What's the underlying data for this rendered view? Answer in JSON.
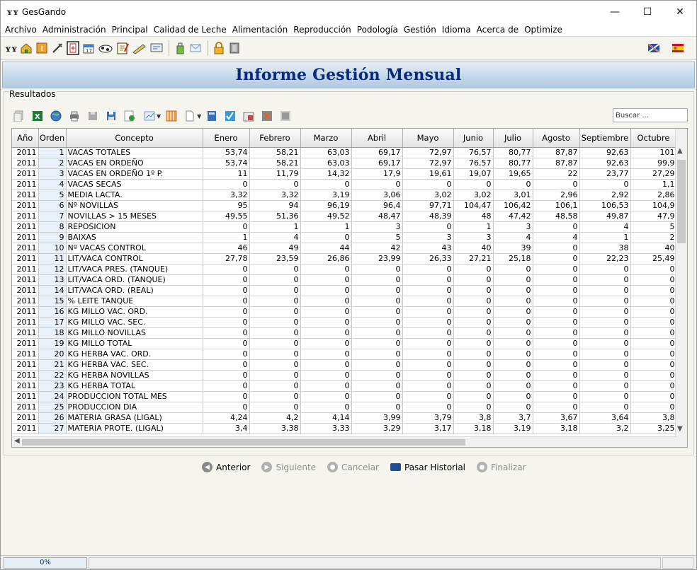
{
  "window": {
    "title": "GesGando",
    "app_icon": "ʏʏ",
    "controls": [
      "—",
      "☐",
      "✕"
    ]
  },
  "menu": [
    "Archivo",
    "Administración",
    "Principal",
    "Calidad de Leche",
    "Alimentación",
    "Reproducción",
    "Podología",
    "Gestión",
    "Idioma",
    "Acerca de",
    "Optimize"
  ],
  "toolbar": {
    "icons": [
      "cow-logo-icon",
      "home-icon",
      "alert-icon",
      "syringe-icon",
      "calculator-icon",
      "calendar-icon",
      "cow-icon",
      "notepad-icon",
      "pen-edit-icon",
      "screen-icon",
      "bottle-icon",
      "mail-icon",
      "lock-icon",
      "door-icon"
    ],
    "right_icons": [
      "flag-uk-icon",
      "flag-es-icon"
    ]
  },
  "banner": {
    "title": "Informe Gestión Mensual"
  },
  "results": {
    "label": "Resultados",
    "search_placeholder": "Buscar ...",
    "grid_icons": [
      "copy-icon",
      "excel-icon",
      "globe-icon",
      "print-icon",
      "save-gray-icon",
      "save-icon",
      "refresh-sheet-icon",
      "chart-icon",
      "columns-icon",
      "page-icon",
      "calc-icon",
      "formula-icon",
      "import-icon",
      "export-icon",
      "barcode-icon"
    ]
  },
  "grid": {
    "columns": [
      "Año",
      "Orden",
      "Concepto",
      "Enero",
      "Febrero",
      "Marzo",
      "Abril",
      "Mayo",
      "Junio",
      "Julio",
      "Agosto",
      "Septiembre",
      "Octubre"
    ],
    "rows": [
      [
        "2011",
        "1",
        "VACAS TOTALES",
        "53,74",
        "58,21",
        "63,03",
        "69,17",
        "72,97",
        "76,57",
        "80,77",
        "87,87",
        "92,63",
        "101"
      ],
      [
        "2011",
        "2",
        "VACAS EN ORDEÑO",
        "53,74",
        "58,21",
        "63,03",
        "69,17",
        "72,97",
        "76,57",
        "80,77",
        "87,87",
        "92,63",
        "99,9"
      ],
      [
        "2011",
        "3",
        "VACAS EN ORDEÑO 1º P.",
        "11",
        "11,79",
        "14,32",
        "17,9",
        "19,61",
        "19,07",
        "19,65",
        "22",
        "23,77",
        "27,29"
      ],
      [
        "2011",
        "4",
        "VACAS SECAS",
        "0",
        "0",
        "0",
        "0",
        "0",
        "0",
        "0",
        "0",
        "0",
        "1,1"
      ],
      [
        "2011",
        "5",
        "MEDIA LACTA.",
        "3,32",
        "3,32",
        "3,19",
        "3,06",
        "3,02",
        "3,02",
        "3,01",
        "2,96",
        "2,92",
        "2,86"
      ],
      [
        "2011",
        "6",
        "Nº NOVILLAS",
        "95",
        "94",
        "96,19",
        "96,4",
        "97,71",
        "104,47",
        "106,42",
        "106,1",
        "106,53",
        "104,9"
      ],
      [
        "2011",
        "7",
        "NOVILLAS > 15 MESES",
        "49,55",
        "51,36",
        "49,52",
        "48,47",
        "48,39",
        "48",
        "47,42",
        "48,58",
        "49,87",
        "47,9"
      ],
      [
        "2011",
        "8",
        "REPOSICION",
        "0",
        "1",
        "1",
        "3",
        "0",
        "1",
        "3",
        "0",
        "4",
        "5"
      ],
      [
        "2011",
        "9",
        "BAIXAS",
        "1",
        "4",
        "0",
        "5",
        "3",
        "3",
        "4",
        "4",
        "1",
        "2"
      ],
      [
        "2011",
        "10",
        "Nº VACAS CONTROL",
        "46",
        "49",
        "44",
        "42",
        "43",
        "40",
        "39",
        "0",
        "38",
        "40"
      ],
      [
        "2011",
        "11",
        "LIT/VACA CONTROL",
        "27,78",
        "23,59",
        "26,86",
        "23,99",
        "26,33",
        "27,21",
        "25,18",
        "0",
        "22,23",
        "25,49"
      ],
      [
        "2011",
        "12",
        "LIT/VACA PRES. (TANQUE)",
        "0",
        "0",
        "0",
        "0",
        "0",
        "0",
        "0",
        "0",
        "0",
        "0"
      ],
      [
        "2011",
        "13",
        "LIT/VACA ORD. (TANQUE)",
        "0",
        "0",
        "0",
        "0",
        "0",
        "0",
        "0",
        "0",
        "0",
        "0"
      ],
      [
        "2011",
        "14",
        "LIT/VACA ORD. (REAL)",
        "0",
        "0",
        "0",
        "0",
        "0",
        "0",
        "0",
        "0",
        "0",
        "0"
      ],
      [
        "2011",
        "15",
        "% LEITE TANQUE",
        "0",
        "0",
        "0",
        "0",
        "0",
        "0",
        "0",
        "0",
        "0",
        "0"
      ],
      [
        "2011",
        "16",
        "KG MILLO VAC. ORD.",
        "0",
        "0",
        "0",
        "0",
        "0",
        "0",
        "0",
        "0",
        "0",
        "0"
      ],
      [
        "2011",
        "17",
        "KG MILLO VAC. SEC.",
        "0",
        "0",
        "0",
        "0",
        "0",
        "0",
        "0",
        "0",
        "0",
        "0"
      ],
      [
        "2011",
        "18",
        "KG MILLO NOVILLAS",
        "0",
        "0",
        "0",
        "0",
        "0",
        "0",
        "0",
        "0",
        "0",
        "0"
      ],
      [
        "2011",
        "19",
        "KG MILLO TOTAL",
        "0",
        "0",
        "0",
        "0",
        "0",
        "0",
        "0",
        "0",
        "0",
        "0"
      ],
      [
        "2011",
        "20",
        "KG HERBA VAC. ORD.",
        "0",
        "0",
        "0",
        "0",
        "0",
        "0",
        "0",
        "0",
        "0",
        "0"
      ],
      [
        "2011",
        "21",
        "KG HERBA VAC. SEC.",
        "0",
        "0",
        "0",
        "0",
        "0",
        "0",
        "0",
        "0",
        "0",
        "0"
      ],
      [
        "2011",
        "22",
        "KG HERBA NOVILLAS",
        "0",
        "0",
        "0",
        "0",
        "0",
        "0",
        "0",
        "0",
        "0",
        "0"
      ],
      [
        "2011",
        "23",
        "KG HERBA TOTAL",
        "0",
        "0",
        "0",
        "0",
        "0",
        "0",
        "0",
        "0",
        "0",
        "0"
      ],
      [
        "2011",
        "24",
        "PRODUCCION TOTAL MES",
        "0",
        "0",
        "0",
        "0",
        "0",
        "0",
        "0",
        "0",
        "0",
        "0"
      ],
      [
        "2011",
        "25",
        "PRODUCCION DIA",
        "0",
        "0",
        "0",
        "0",
        "0",
        "0",
        "0",
        "0",
        "0",
        "0"
      ],
      [
        "2011",
        "26",
        "MATERIA GRASA (LIGAL)",
        "4,24",
        "4,2",
        "4,14",
        "3,99",
        "3,79",
        "3,8",
        "3,7",
        "3,67",
        "3,64",
        "3,8"
      ],
      [
        "2011",
        "27",
        "MATERIA PROTE. (LIGAL)",
        "3,4",
        "3,38",
        "3,33",
        "3,29",
        "3,17",
        "3,18",
        "3,19",
        "3,18",
        "3,2",
        "3,25"
      ]
    ]
  },
  "wizard": {
    "buttons": [
      {
        "label": "Anterior",
        "icon": "back-arrow-icon",
        "enabled": true,
        "color": "#8a8a8a",
        "glyph": "◀"
      },
      {
        "label": "Siguiente",
        "icon": "forward-arrow-icon",
        "enabled": false,
        "color": "#b0b0b0",
        "glyph": "▶"
      },
      {
        "label": "Cancelar",
        "icon": "cancel-icon",
        "enabled": false,
        "color": "#b0b0b0",
        "glyph": "●"
      },
      {
        "label": "Pasar Historial",
        "icon": "book-icon",
        "enabled": true,
        "color": "#1f4f9a",
        "glyph": "▬"
      },
      {
        "label": "Finalizar",
        "icon": "finish-icon",
        "enabled": false,
        "color": "#b0b0b0",
        "glyph": "●"
      }
    ]
  },
  "status": {
    "progress_text": "0%",
    "progress": 0
  }
}
